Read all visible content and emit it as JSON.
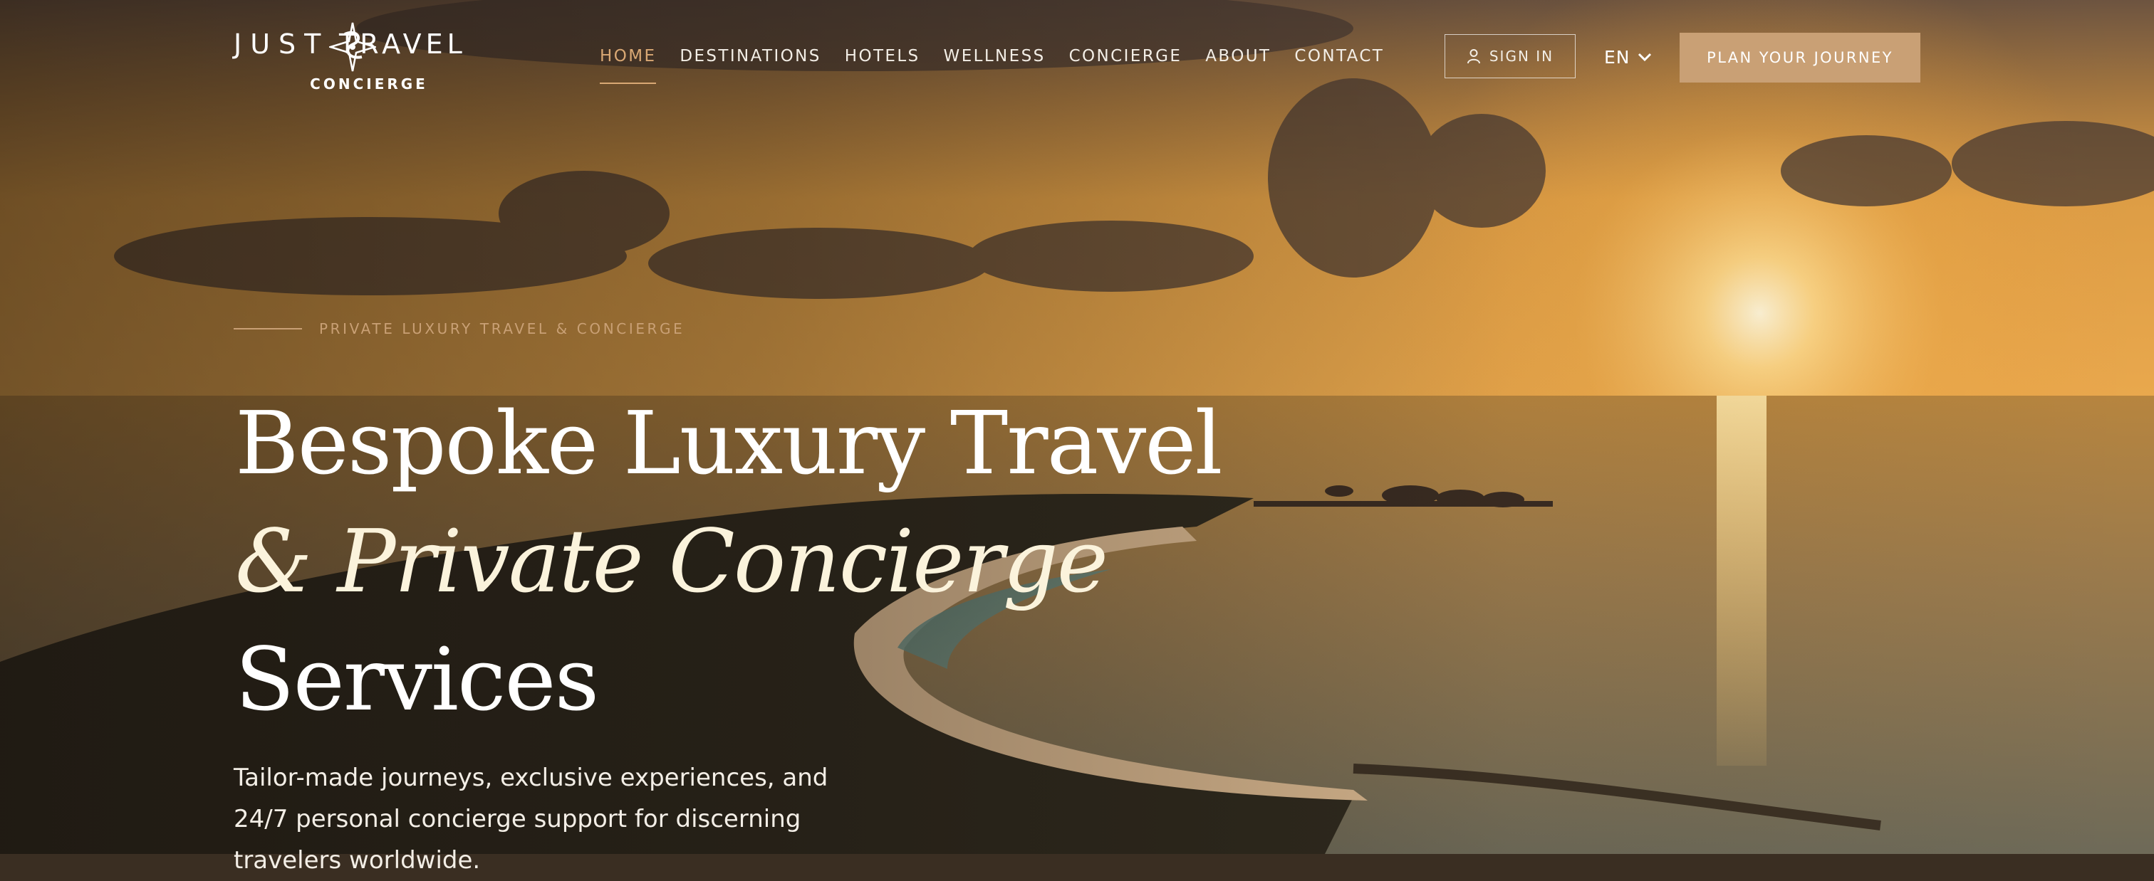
{
  "brand": {
    "name_left": "JUST",
    "name_right": "TRAVEL",
    "tagline": "CONCIERGE"
  },
  "nav": {
    "items": [
      {
        "label": "HOME",
        "active": true
      },
      {
        "label": "DESTINATIONS",
        "active": false
      },
      {
        "label": "HOTELS",
        "active": false
      },
      {
        "label": "WELLNESS",
        "active": false
      },
      {
        "label": "CONCIERGE",
        "active": false
      },
      {
        "label": "ABOUT",
        "active": false
      },
      {
        "label": "CONTACT",
        "active": false
      }
    ]
  },
  "header_actions": {
    "sign_in_label": "SIGN IN",
    "sign_in_icon": "user-icon",
    "language": "EN",
    "language_icon": "chevron-down-icon",
    "cta_label": "PLAN YOUR JOURNEY"
  },
  "hero": {
    "eyebrow": "PRIVATE LUXURY TRAVEL & CONCIERGE",
    "headline_line1": "Bespoke Luxury Travel",
    "headline_line2": "& Private Concierge",
    "headline_line3": "Services",
    "subtext": "Tailor-made journeys, exclusive experiences, and 24/7 personal concierge support for discerning travelers worldwide."
  },
  "colors": {
    "accent": "#c9a075",
    "nav_active": "#d9a874",
    "text": "#ffffff"
  }
}
